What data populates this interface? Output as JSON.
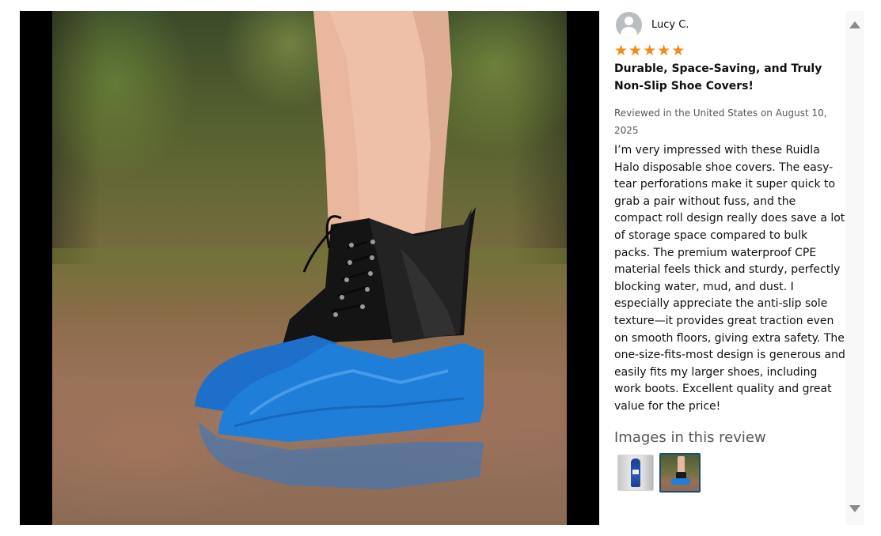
{
  "review": {
    "reviewer_name": "Lucy C.",
    "rating": 5,
    "max_rating": 5,
    "stars": [
      "★",
      "★",
      "★",
      "★",
      "★"
    ],
    "title": "Durable, Space-Saving, and Truly Non-Slip Shoe Covers!",
    "date": "Reviewed in the United States on August 10, 2025",
    "body": "I’m very impressed with these Ruidla Halo disposable shoe covers. The easy-tear perforations make it super quick to grab a pair without fuss, and the compact roll design really does save a lot of storage space compared to bulk packs. The premium waterproof CPE material feels thick and sturdy, perfectly blocking water, mud, and dust. I especially appreciate the anti-slip sole texture—it provides great traction even on smooth floors, giving extra safety. The one-size-fits-most design is generous and easily fits my larger shoes, including work boots. Excellent quality and great value for the price!",
    "images_heading": "Images in this review",
    "selected_thumbnail": 2
  },
  "colors": {
    "star": "#f28b13",
    "selected_border": "#1f4b6e",
    "muted_text": "#565959",
    "shoe_cover": "#1f7ed8"
  },
  "icons": {
    "avatar": "default-user-avatar-icon",
    "scroll_up": "triangle-up-icon",
    "scroll_down": "triangle-down-icon",
    "star": "star-icon"
  }
}
